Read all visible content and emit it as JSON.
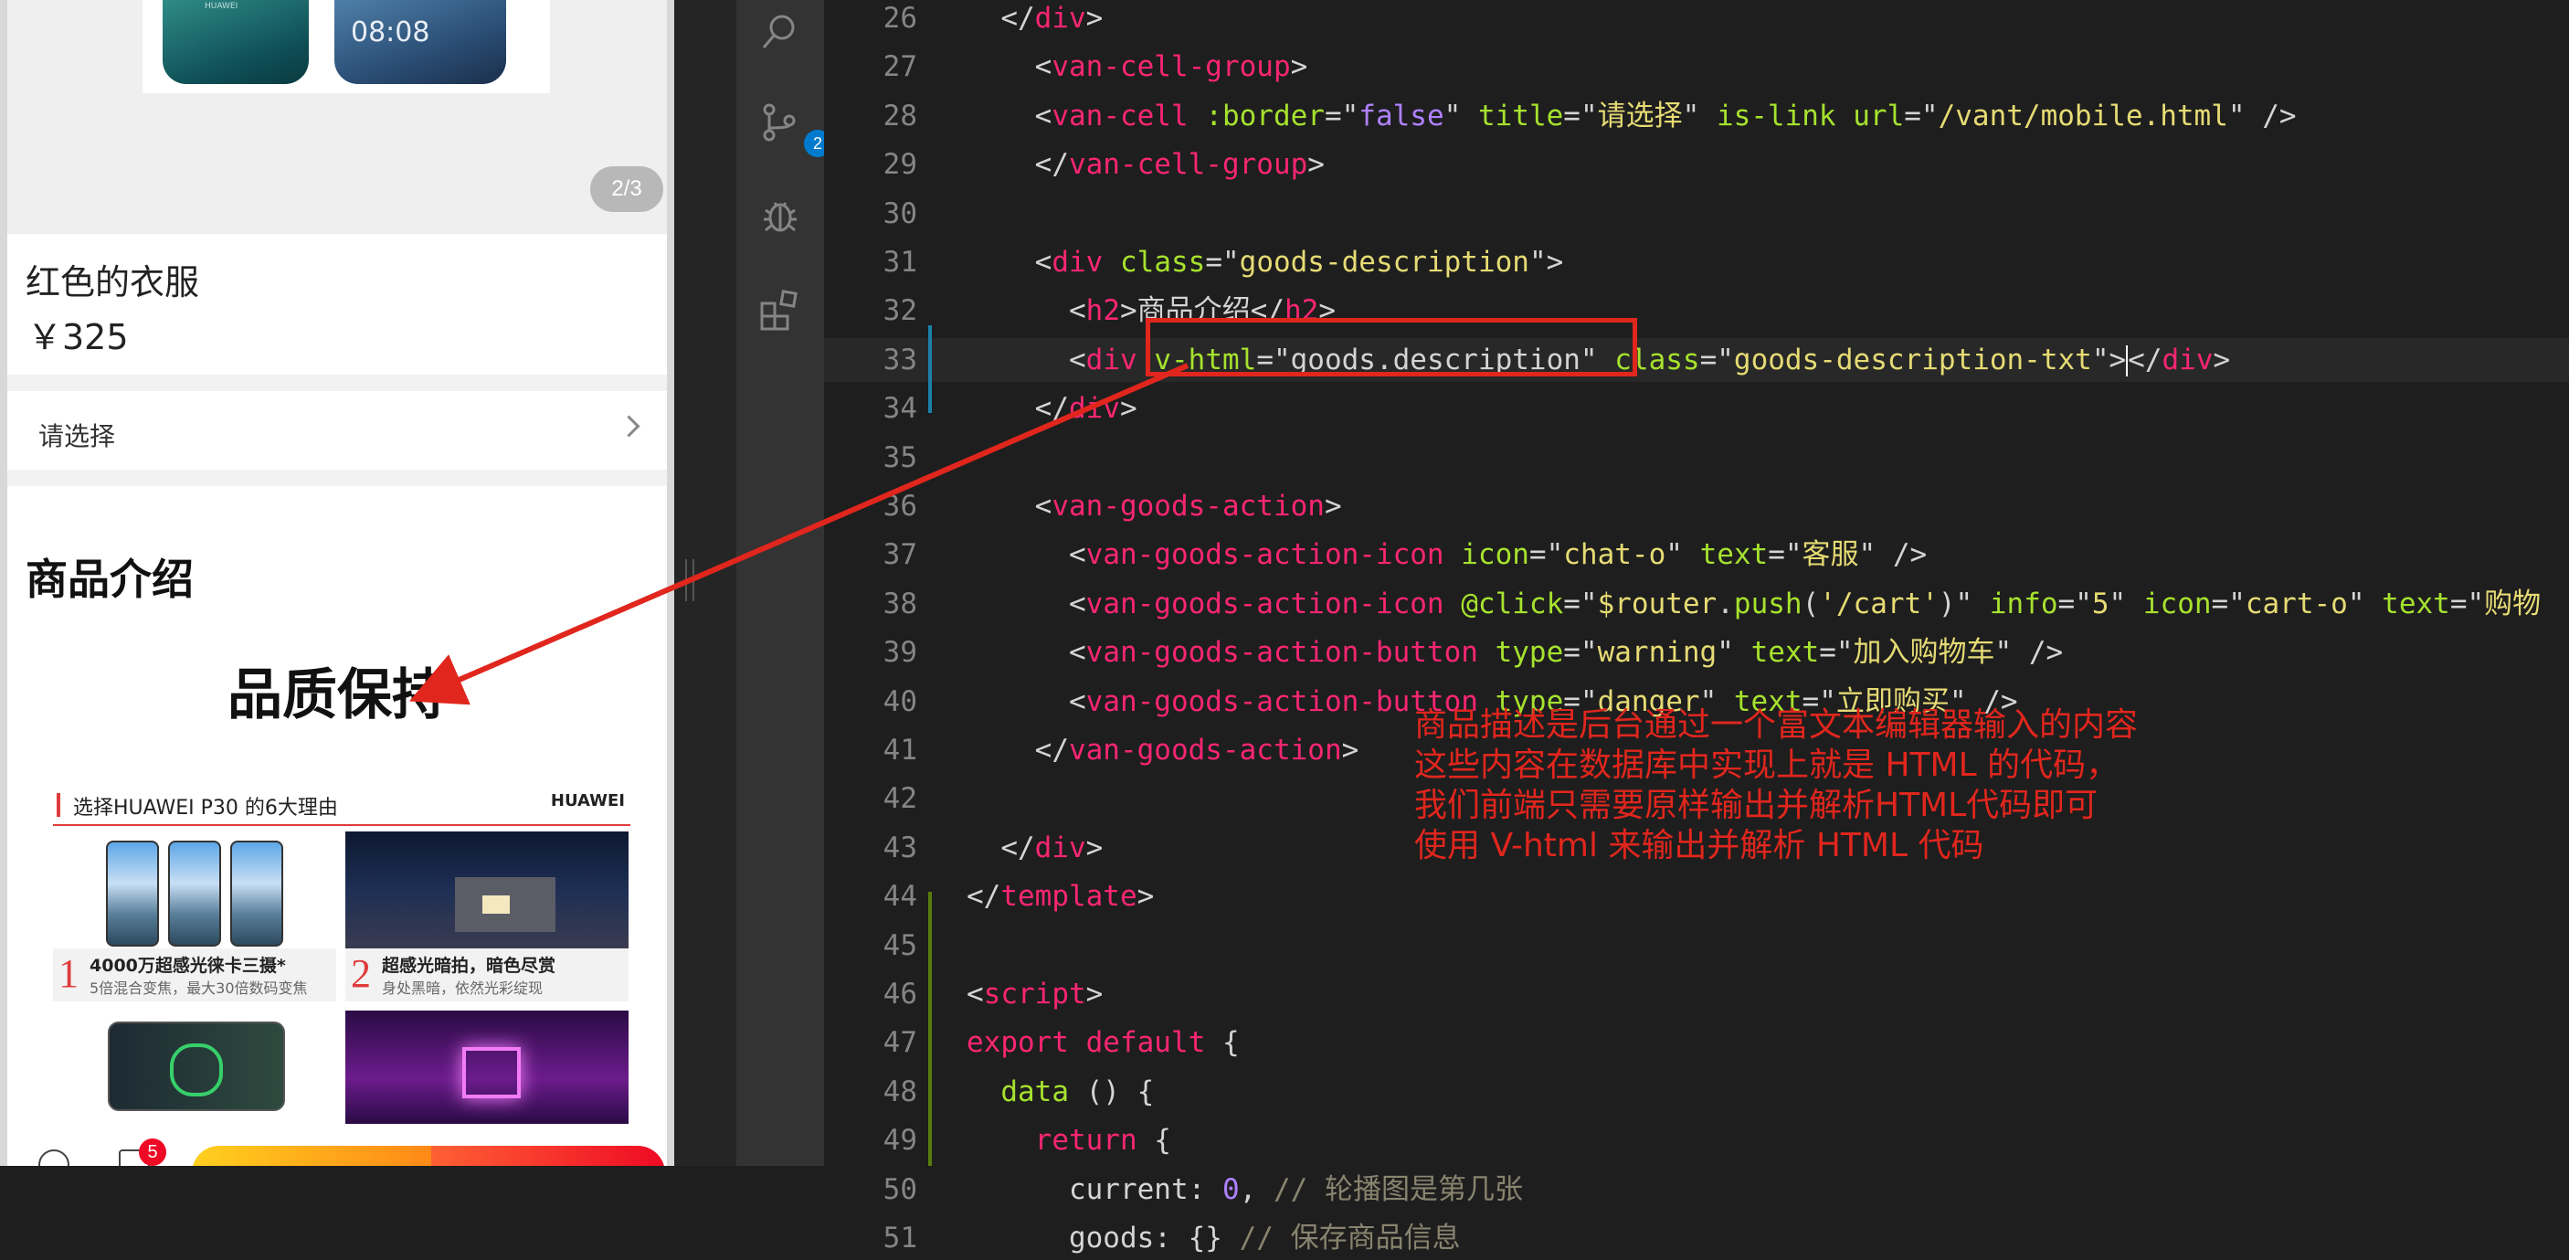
{
  "preview": {
    "phone_clock": "08:08",
    "phone_brand": "HUAWEI",
    "pager": "2/3",
    "title": "红色的衣服",
    "price": "￥325",
    "cell_title": "请选择",
    "desc_heading": "商品介绍",
    "desc_big_title": "品质保持",
    "banner_text": "选择HUAWEI P30 的6大理由",
    "banner_logo": "HUAWEI",
    "tiles": [
      {
        "num": "1",
        "line1": "4000万超感光徕卡三摄*",
        "line2": "5倍混合变焦，最大30倍数码变焦"
      },
      {
        "num": "2",
        "line1": "超感光暗拍，暗色尽赏",
        "line2": "身处黑暗，依然光彩绽现"
      }
    ],
    "cart_badge": "5"
  },
  "activity": {
    "icons": [
      "search-icon",
      "source-control-icon",
      "debug-icon",
      "extensions-icon"
    ],
    "scm_badge": "2"
  },
  "editor": {
    "lines": [
      {
        "n": "26",
        "parts": [
          [
            "pl",
            "  </"
          ],
          [
            "tag",
            "div"
          ],
          [
            "pl",
            ">"
          ]
        ]
      },
      {
        "n": "27",
        "parts": [
          [
            "pl",
            "    <"
          ],
          [
            "tag",
            "van-cell-group"
          ],
          [
            "pl",
            ">"
          ]
        ]
      },
      {
        "n": "28",
        "parts": [
          [
            "pl",
            "    <"
          ],
          [
            "tag",
            "van-cell"
          ],
          [
            "pl",
            " "
          ],
          [
            "attr",
            ":border"
          ],
          [
            "pl",
            "=\""
          ],
          [
            "bool",
            "false"
          ],
          [
            "pl",
            "\" "
          ],
          [
            "attr",
            "title"
          ],
          [
            "pl",
            "=\""
          ],
          [
            "str",
            "请选择"
          ],
          [
            "pl",
            "\" "
          ],
          [
            "attr",
            "is-link"
          ],
          [
            "pl",
            " "
          ],
          [
            "attr",
            "url"
          ],
          [
            "pl",
            "=\""
          ],
          [
            "str",
            "/vant/mobile.html"
          ],
          [
            "pl",
            "\" />"
          ]
        ]
      },
      {
        "n": "29",
        "parts": [
          [
            "pl",
            "    </"
          ],
          [
            "tag",
            "van-cell-group"
          ],
          [
            "pl",
            ">"
          ]
        ]
      },
      {
        "n": "30",
        "parts": []
      },
      {
        "n": "31",
        "parts": [
          [
            "pl",
            "    <"
          ],
          [
            "tag",
            "div"
          ],
          [
            "pl",
            " "
          ],
          [
            "attr",
            "class"
          ],
          [
            "pl",
            "=\""
          ],
          [
            "str",
            "goods-description"
          ],
          [
            "pl",
            "\">"
          ]
        ]
      },
      {
        "n": "32",
        "parts": [
          [
            "pl",
            "      <"
          ],
          [
            "tag",
            "h2"
          ],
          [
            "pl",
            ">商品介绍</"
          ],
          [
            "tag",
            "h2"
          ],
          [
            "pl",
            ">"
          ]
        ]
      },
      {
        "n": "33",
        "parts": [
          [
            "pl",
            "      <"
          ],
          [
            "tag",
            "div"
          ],
          [
            "pl",
            " "
          ],
          [
            "attr",
            "v-html"
          ],
          [
            "pl",
            "=\""
          ],
          [
            "pl",
            "goods.description"
          ],
          [
            "pl",
            "\" "
          ],
          [
            "attr",
            "class"
          ],
          [
            "pl",
            "=\""
          ],
          [
            "str",
            "goods-description-txt"
          ],
          [
            "pl",
            "\">"
          ],
          [
            "cursor",
            ""
          ],
          [
            "pl",
            "</"
          ],
          [
            "tag",
            "div"
          ],
          [
            "pl",
            ">"
          ]
        ]
      },
      {
        "n": "34",
        "parts": [
          [
            "pl",
            "    </"
          ],
          [
            "tag",
            "div"
          ],
          [
            "pl",
            ">"
          ]
        ]
      },
      {
        "n": "35",
        "parts": []
      },
      {
        "n": "36",
        "parts": [
          [
            "pl",
            "    <"
          ],
          [
            "tag",
            "van-goods-action"
          ],
          [
            "pl",
            ">"
          ]
        ]
      },
      {
        "n": "37",
        "parts": [
          [
            "pl",
            "      <"
          ],
          [
            "tag",
            "van-goods-action-icon"
          ],
          [
            "pl",
            " "
          ],
          [
            "attr",
            "icon"
          ],
          [
            "pl",
            "=\""
          ],
          [
            "str",
            "chat-o"
          ],
          [
            "pl",
            "\" "
          ],
          [
            "attr",
            "text"
          ],
          [
            "pl",
            "=\""
          ],
          [
            "str",
            "客服"
          ],
          [
            "pl",
            "\" />"
          ]
        ]
      },
      {
        "n": "38",
        "parts": [
          [
            "pl",
            "      <"
          ],
          [
            "tag",
            "van-goods-action-icon"
          ],
          [
            "pl",
            " "
          ],
          [
            "attr",
            "@click"
          ],
          [
            "pl",
            "=\""
          ],
          [
            "str",
            "$router"
          ],
          [
            "pl",
            "."
          ],
          [
            "fn",
            "push"
          ],
          [
            "pl",
            "("
          ],
          [
            "str",
            "'/cart'"
          ],
          [
            "pl",
            ")\" "
          ],
          [
            "attr",
            "info"
          ],
          [
            "pl",
            "=\""
          ],
          [
            "str",
            "5"
          ],
          [
            "pl",
            "\" "
          ],
          [
            "attr",
            "icon"
          ],
          [
            "pl",
            "=\""
          ],
          [
            "str",
            "cart-o"
          ],
          [
            "pl",
            "\" "
          ],
          [
            "attr",
            "text"
          ],
          [
            "pl",
            "=\""
          ],
          [
            "str",
            "购物"
          ]
        ]
      },
      {
        "n": "39",
        "parts": [
          [
            "pl",
            "      <"
          ],
          [
            "tag",
            "van-goods-action-button"
          ],
          [
            "pl",
            " "
          ],
          [
            "attr",
            "type"
          ],
          [
            "pl",
            "=\""
          ],
          [
            "str",
            "warning"
          ],
          [
            "pl",
            "\" "
          ],
          [
            "attr",
            "text"
          ],
          [
            "pl",
            "=\""
          ],
          [
            "str",
            "加入购物车"
          ],
          [
            "pl",
            "\" />"
          ]
        ]
      },
      {
        "n": "40",
        "parts": [
          [
            "pl",
            "      <"
          ],
          [
            "tag",
            "van-goods-action-button"
          ],
          [
            "pl",
            " "
          ],
          [
            "attr",
            "type"
          ],
          [
            "pl",
            "=\""
          ],
          [
            "str",
            "danger"
          ],
          [
            "pl",
            "\" "
          ],
          [
            "attr",
            "text"
          ],
          [
            "pl",
            "=\""
          ],
          [
            "str",
            "立即购买"
          ],
          [
            "pl",
            "\" />"
          ]
        ]
      },
      {
        "n": "41",
        "parts": [
          [
            "pl",
            "    </"
          ],
          [
            "tag",
            "van-goods-action"
          ],
          [
            "pl",
            ">"
          ]
        ]
      },
      {
        "n": "42",
        "parts": []
      },
      {
        "n": "43",
        "parts": [
          [
            "pl",
            "  </"
          ],
          [
            "tag",
            "div"
          ],
          [
            "pl",
            ">"
          ]
        ]
      },
      {
        "n": "44",
        "parts": [
          [
            "pl",
            "</"
          ],
          [
            "tag",
            "template"
          ],
          [
            "pl",
            ">"
          ]
        ]
      },
      {
        "n": "45",
        "parts": []
      },
      {
        "n": "46",
        "parts": [
          [
            "pl",
            "<"
          ],
          [
            "tag",
            "script"
          ],
          [
            "pl",
            ">"
          ]
        ]
      },
      {
        "n": "47",
        "parts": [
          [
            "kw",
            "export default"
          ],
          [
            "pl",
            " {"
          ]
        ]
      },
      {
        "n": "48",
        "parts": [
          [
            "pl",
            "  "
          ],
          [
            "fn",
            "data"
          ],
          [
            "pl",
            " () {"
          ]
        ]
      },
      {
        "n": "49",
        "parts": [
          [
            "pl",
            "    "
          ],
          [
            "kw",
            "return"
          ],
          [
            "pl",
            " {"
          ]
        ]
      },
      {
        "n": "50",
        "parts": [
          [
            "pl",
            "      current: "
          ],
          [
            "num",
            "0"
          ],
          [
            "pl",
            ", "
          ],
          [
            "com",
            "// 轮播图是第几张"
          ]
        ]
      },
      {
        "n": "51",
        "parts": [
          [
            "pl",
            "      goods: {} "
          ],
          [
            "com",
            "// 保存商品信息"
          ]
        ]
      }
    ],
    "highlight_line": "33"
  },
  "annotation": [
    "商品描述是后台通过一个富文本编辑器输入的内容",
    "这些内容在数据库中实现上就是 HTML 的代码，",
    "我们前端只需要原样输出并解析HTML代码即可",
    "使用 V-html 来输出并解析 HTML 代码"
  ]
}
